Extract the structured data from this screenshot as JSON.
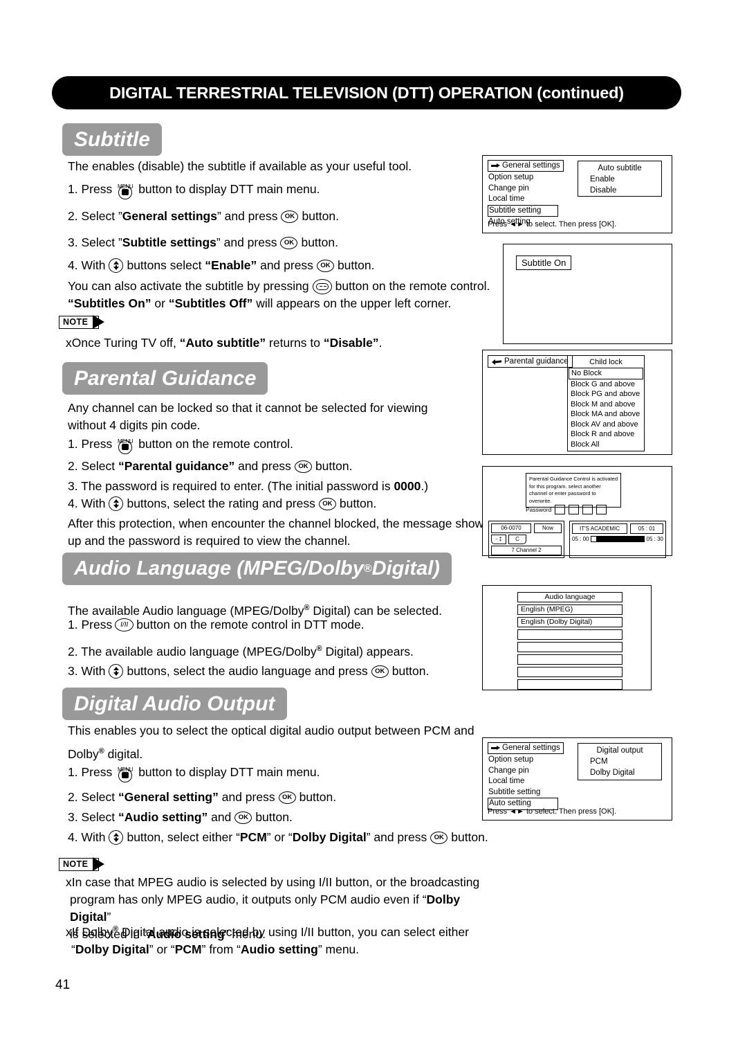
{
  "header": {
    "title": "DIGITAL TERRESTRIAL TELEVISION (DTT) OPERATION (continued)"
  },
  "page_number": "41",
  "sections": {
    "subtitle": {
      "banner": "Subtitle",
      "intro": "The enables (disable) the subtitle if available as your useful tool.",
      "steps": [
        {
          "num": "1. Press",
          "tail": "button to display DTT main menu."
        },
        {
          "num": "2. Select ”General settings” and press",
          "tail": "button."
        },
        {
          "num": "3. Select ”Subtitle settings” and press",
          "tail": "button."
        },
        {
          "num": "4. With",
          "mid": "buttons select “Enable” and press",
          "tail": "button."
        }
      ],
      "extra_line1_a": "You can also activate the subtitle by pressing",
      "extra_line1_b": "button on the remote control.",
      "extra_line2": "“Subtitles On” or “Subtitles Off” will appears on the upper left corner.",
      "note_label": "NOTE",
      "note_text": "xOnce Turing TV off, “Auto subtitle” returns to “Disable”."
    },
    "parental": {
      "banner": "Parental Guidance",
      "intro": "Any channel can be locked so that it cannot be selected for viewing without 4 digits pin code.",
      "step1": "1. Press",
      "step1_tail": "button on the remote control.",
      "step2": "2. Select “Parental guidance” and press",
      "step2_tail": "button.",
      "step3": "3. The password is required to enter. (The initial password is 0000.)",
      "step4": "4. With",
      "step4_mid": "buttons, select the rating and press",
      "step4_tail": "button.",
      "outro": "After this protection, when encounter the channel blocked, the message show up and the password is required to view the channel."
    },
    "audio_language": {
      "banner_a": "Audio Language (MPEG/Dolby",
      "banner_reg": "®",
      "banner_b": " Digital)",
      "intro_a": "The available Audio language (MPEG/Dolby",
      "intro_reg": "®",
      "intro_b": " Digital) can be selected.",
      "step1": "1. Press",
      "step1_tail": "button on the remote control in DTT mode.",
      "step2_a": "2. The available audio language (MPEG/Dolby",
      "step2_b": " Digital) appears.",
      "step3": "3. With",
      "step3_mid": "buttons, select the audio language and press",
      "step3_tail": "button."
    },
    "digital_output": {
      "banner": "Digital Audio Output",
      "intro_a": "This enables you to select the optical digital audio output between PCM and",
      "intro_b": "Dolby",
      "intro_reg": "®",
      "intro_c": " digital.",
      "step1": "1. Press",
      "step1_tail": "button to display DTT main menu.",
      "step2": "2. Select “General setting” and press",
      "step2_tail": "button.",
      "step3": "3. Select “Audio setting” and",
      "step3_tail": "button.",
      "step4": "4. With",
      "step4_mid": "button, select either “PCM” or “Dolby Digital” and press",
      "step4_tail": "button.",
      "note_label": "NOTE",
      "note1_l1": "xIn case that MPEG audio is selected by using I/II button, or the broadcasting",
      "note1_l2": "program has only MPEG audio, it outputs only PCM audio even if “Dolby Digital”",
      "note1_l3": "is selected in “Audio setting” menu.",
      "note2_l1_a": "xIf Dolby",
      "note2_l1_reg": "®",
      "note2_l1_b": " Digital audio is selected by using I/II button, you can select either",
      "note2_l2": "“Dolby Digital” or “PCM” from “Audio setting” menu."
    }
  },
  "panels": {
    "general_settings_subtitle": {
      "head": "General settings",
      "items": [
        "Option setup",
        "Change pin",
        "Local time",
        "Subtitle setting",
        "Auto setting"
      ],
      "selected": "Subtitle setting",
      "right_title": "Auto subtitle",
      "right_options": [
        "Enable",
        "Disable"
      ],
      "footer": "Press ◄► to select. Then press [OK]."
    },
    "subtitle_on": {
      "tag": "Subtitle On"
    },
    "parental_guidance": {
      "head": "Parental guidance",
      "right_title": "Child lock",
      "options": [
        "No Block",
        "Block G and above",
        "Block PG and above",
        "Block M and above",
        "Block MA and above",
        "Block AV and above",
        "Block R and above",
        "Block All"
      ],
      "selected": "No Block"
    },
    "password_epg": {
      "message_l1": "Parental Guidance Control is activated",
      "message_l2": "for this program. select another",
      "message_l3": "channel or enter password to overwrite.",
      "password_label": "Password",
      "password_cells": 4,
      "channel_number": "06-0070",
      "now_label": "Now",
      "updown": "- ‡",
      "c_label": "C",
      "channel_name": "7 Channel 2",
      "program_title": "IT'S ACADEMIC",
      "program_time": "05 : 01",
      "start_time": "05 : 00",
      "end_time": "05 : 30"
    },
    "audio_language_menu": {
      "title": "Audio language",
      "rows": [
        "English (MPEG)",
        "English (Dolby Digital)",
        "",
        "",
        "",
        "",
        ""
      ]
    },
    "general_settings_output": {
      "head": "General settings",
      "items": [
        "Option setup",
        "Change pin",
        "Local time",
        "Subtitle setting",
        "Auto setting"
      ],
      "selected": "Auto setting",
      "right_title": "Digital output",
      "right_options": [
        "PCM",
        "Dolby Digital"
      ],
      "footer": "Press ◄► to select. Then press [OK]."
    }
  },
  "colors": {
    "banner_gray": "#999999",
    "header_black": "#000000"
  }
}
